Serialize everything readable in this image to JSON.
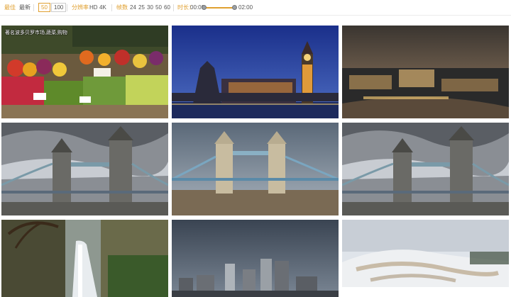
{
  "filters": {
    "sort": {
      "options": [
        "最佳",
        "最新"
      ]
    },
    "page_size": {
      "options": [
        "50",
        "100"
      ],
      "selected": "50"
    },
    "resolution": {
      "label": "分辨率",
      "options": [
        "HD",
        "4K"
      ]
    },
    "fps": {
      "label": "帧数",
      "options": [
        "24",
        "25",
        "30",
        "50",
        "60"
      ]
    },
    "duration": {
      "label": "时长：",
      "start": "00:00",
      "end": "02:00"
    }
  },
  "videos": [
    {
      "caption": "著名波多贝罗市场,蔬菜,购物",
      "subject": "market vegetables"
    },
    {
      "caption": "",
      "subject": "big ben night"
    },
    {
      "caption": "",
      "subject": "city night aerial"
    },
    {
      "caption": "",
      "subject": "tower bridge clouds"
    },
    {
      "caption": "",
      "subject": "tower bridge blue sky"
    },
    {
      "caption": "",
      "subject": "tower bridge clouds"
    },
    {
      "caption": "",
      "subject": "waterfall"
    },
    {
      "caption": "",
      "subject": "city skyline cloudy"
    },
    {
      "caption": "",
      "subject": "snow hot springs"
    }
  ],
  "colors": {
    "accent": "#e0a030"
  }
}
